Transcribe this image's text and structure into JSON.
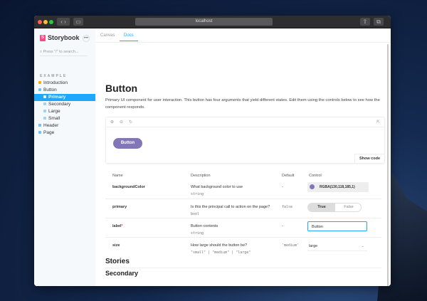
{
  "browser": {
    "url": "localhost"
  },
  "sidebar": {
    "brand": "Storybook",
    "search_placeholder": "Press \"/\" to search...",
    "section": "EXAMPLE",
    "items": [
      {
        "label": "Introduction"
      },
      {
        "label": "Button"
      },
      {
        "label": "Primary"
      },
      {
        "label": "Secondary"
      },
      {
        "label": "Large"
      },
      {
        "label": "Small"
      },
      {
        "label": "Header"
      },
      {
        "label": "Page"
      }
    ]
  },
  "tabs": [
    {
      "label": "Canvas"
    },
    {
      "label": "Docs"
    }
  ],
  "doc": {
    "title": "Button",
    "description": "Primary UI component for user interaction. This button has four arguments that yield different states. Edit them using the controls below to see how the component responds.",
    "preview_button": "Button",
    "show_code": "Show code"
  },
  "table": {
    "headers": [
      "Name",
      "Description",
      "Default",
      "Control"
    ],
    "rows": [
      {
        "name": "backgroundColor",
        "desc": "What background color to use",
        "type": "string",
        "default": "-",
        "control": "RGBA(130,118,185,1)"
      },
      {
        "name": "primary",
        "desc": "Is this the principal call to action on the page?",
        "type": "bool",
        "default": "false",
        "true": "True",
        "false": "False"
      },
      {
        "name": "label",
        "required": "*",
        "desc": "Button contents",
        "type": "string",
        "default": "-",
        "control": "Button"
      },
      {
        "name": "size",
        "desc": "How large should the button be?",
        "type": "\"small\" | \"medium\" | \"large\"",
        "default": "'medium'",
        "control": "large"
      }
    ]
  },
  "stories": {
    "heading": "Stories",
    "first": "Secondary"
  },
  "colors": {
    "accent": "#1ea7fd",
    "button": "#8276b9"
  }
}
